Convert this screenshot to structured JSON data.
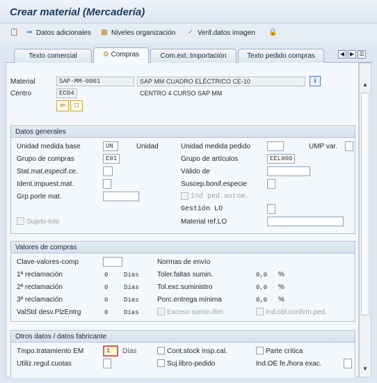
{
  "title": "Crear material (Mercadería)",
  "toolbar": [
    {
      "icon": "clipboard-icon",
      "label": ""
    },
    {
      "icon": "arrow-right-icon",
      "label": "Datos adicionales"
    },
    {
      "icon": "org-levels-icon",
      "label": "Niveles organización"
    },
    {
      "icon": "verify-data-icon",
      "label": "Verif.datos imagen"
    },
    {
      "icon": "lock-icon",
      "label": ""
    }
  ],
  "tabs": [
    {
      "label": "Texto comercial",
      "active": false
    },
    {
      "label": "Compras",
      "active": true
    },
    {
      "label": "Com.ext.:Importación",
      "active": false
    },
    {
      "label": "Texto pedido compras",
      "active": false
    }
  ],
  "header": {
    "material_label": "Material",
    "material_value": "SAP-MM-0001",
    "material_desc": "SAP MM CUADRO ELÉCTRICO CE-10",
    "centro_label": "Centro",
    "centro_value": "EC04",
    "centro_desc": "CENTRO 4 CURSO SAP MM"
  },
  "datos_generales": {
    "title": "Datos generales",
    "unidad_medida_base_label": "Unidad medida base",
    "unidad_medida_base_value": "UN",
    "unidad_medida_base_text": "Unidad",
    "unidad_medida_pedido_label": "Unidad medida pedido",
    "ump_var_label": "UMP var.",
    "grupo_compras_label": "Grupo de compras",
    "grupo_compras_value": "E01",
    "grupo_articulos_label": "Grupo de artículos",
    "grupo_articulos_value": "EEL000",
    "stat_mat_label": "Stat.mat.especif.ce.",
    "valido_de_label": "Válido de",
    "ident_impuest_label": "Ident.impuest.mat.",
    "suscep_bonif_label": "Suscep.bonif.especie",
    "grp_porte_label": "Grp.porte mat.",
    "ind_ped_autom_label": "Ind ped.autom.",
    "gestion_lo_label": "Gestión LO",
    "sujeto_lote_label": "Sujeto-lote",
    "material_ref_lo_label": "Material ref.LO"
  },
  "valores_compras": {
    "title": "Valores de compras",
    "clave_valores_label": "Clave-valores-comp",
    "normas_envio_label": "Normas de envío",
    "rec1_label": "1ª reclamación",
    "rec1_value": "0",
    "rec2_label": "2ª reclamación",
    "rec2_value": "0",
    "rec3_label": "3ª reclamación",
    "rec3_value": "0",
    "valstd_label": "ValStd desv.PlzEntrg",
    "valstd_value": "0",
    "dias": "Días",
    "toler_faltas_label": "Toler.faltas sumin.",
    "toler_faltas_value": "0,0",
    "tol_exc_label": "Tol.exc.suministro",
    "tol_exc_value": "0,0",
    "porc_entrega_label": "Porc.entrega mínima",
    "porc_entrega_value": "0,0",
    "percent": "%",
    "exceso_label": "Exceso sumin.ilim.",
    "ind_obl_label": "Ind.obl.confirm.ped."
  },
  "otros_datos": {
    "title": "Otros datos / datos fabricante",
    "tmpo_label": "Tmpo.tratamiento EM",
    "tmpo_value": "1",
    "tmpo_unit": "Días",
    "cont_stock_label": "Cont.stock insp.cal.",
    "parte_critica_label": "Parte crítica",
    "utiliz_label": "Utiliz.regul.cuotas",
    "suj_libro_label": "Suj.libro-pedido",
    "ind_oe_label": "Ind.OE fe./hora exac."
  },
  "colors": {
    "accent": "#1f3a5a",
    "panel": "#f4f7fb",
    "group_header": "#d6e1ed"
  }
}
